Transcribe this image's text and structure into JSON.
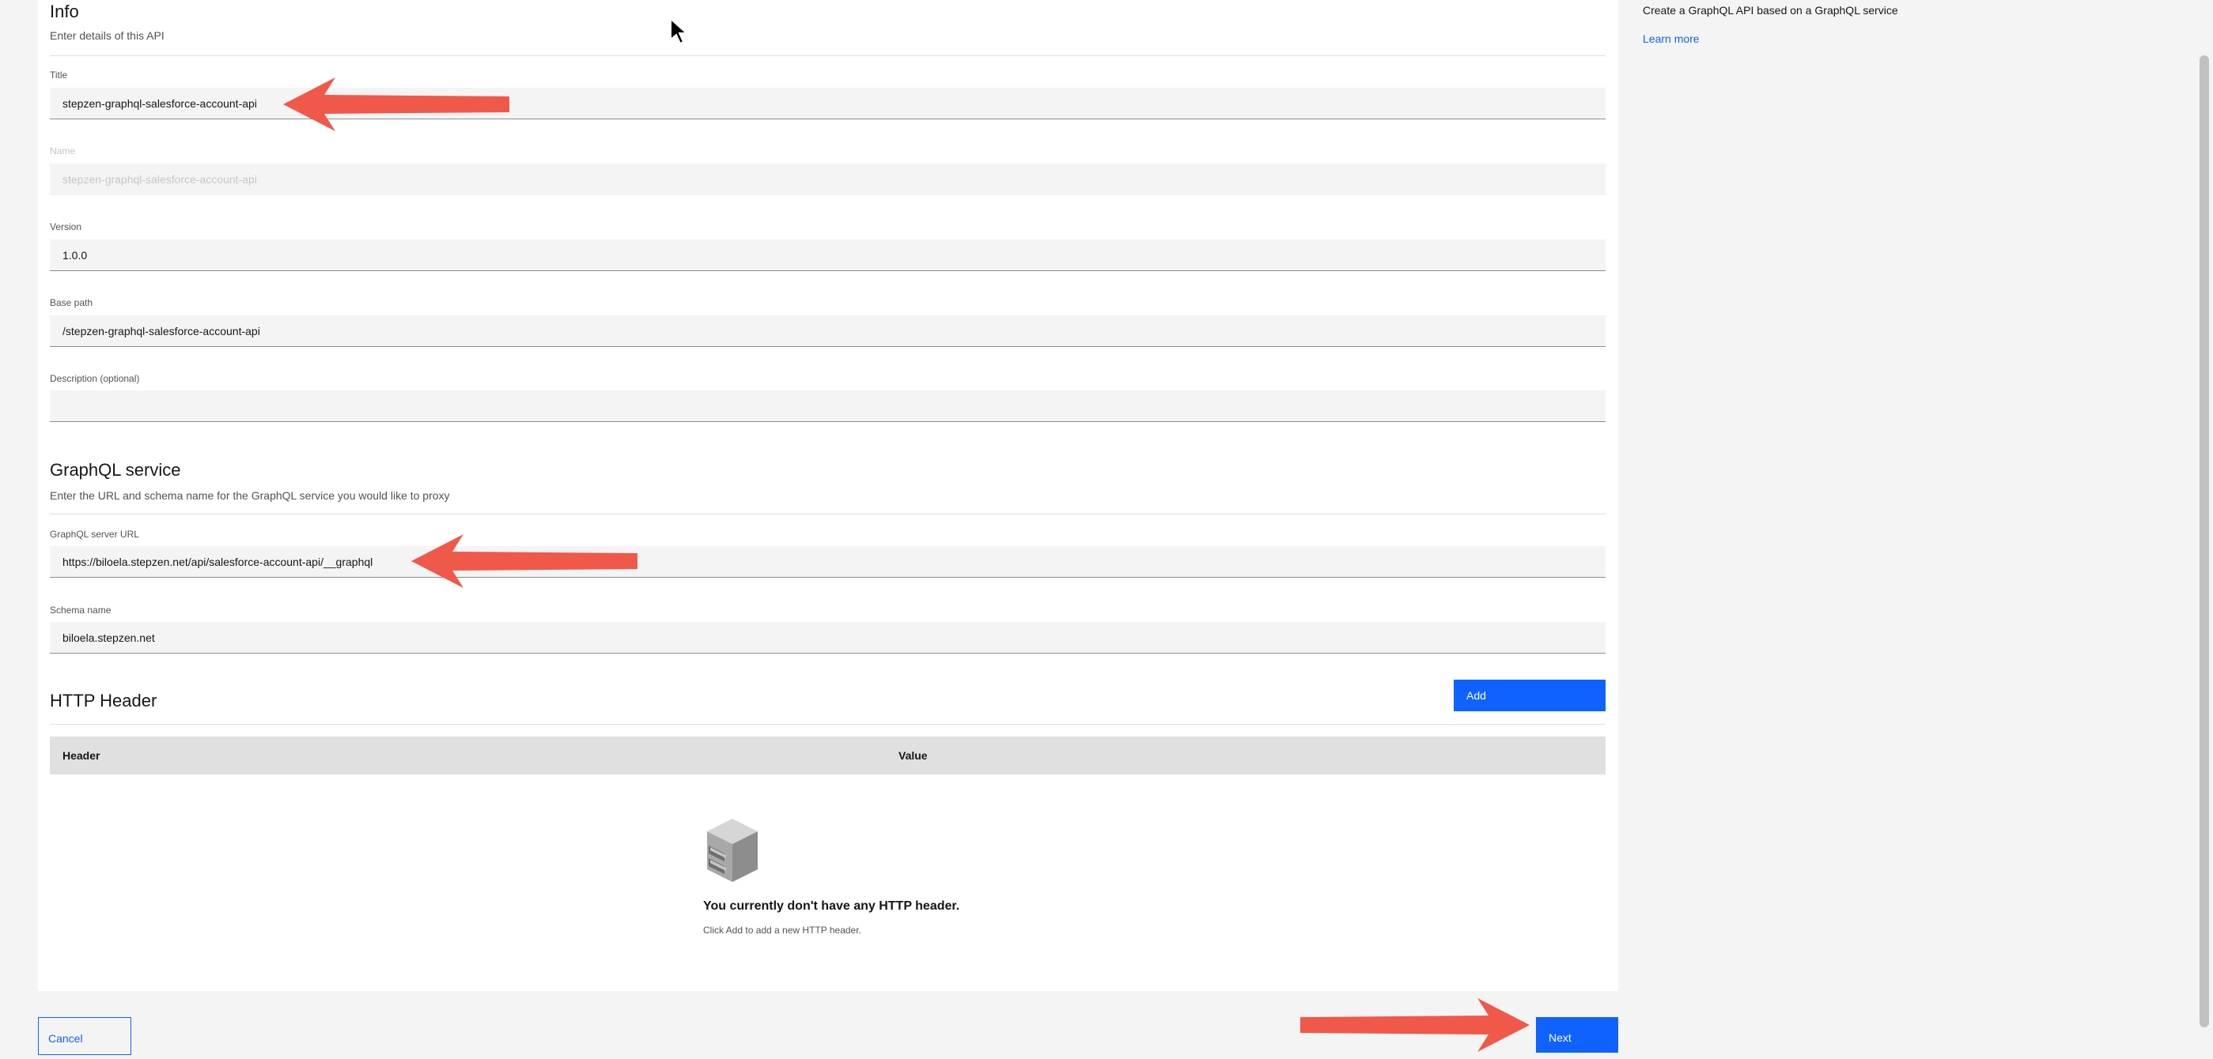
{
  "info": {
    "heading": "Info",
    "subtitle": "Enter details of this API"
  },
  "fields": {
    "title": {
      "label": "Title",
      "value": "stepzen-graphql-salesforce-account-api"
    },
    "name": {
      "label": "Name",
      "value": "stepzen-graphql-salesforce-account-api"
    },
    "version": {
      "label": "Version",
      "value": "1.0.0"
    },
    "base_path": {
      "label": "Base path",
      "value": "/stepzen-graphql-salesforce-account-api"
    },
    "description": {
      "label": "Description (optional)",
      "value": ""
    }
  },
  "graphql": {
    "heading": "GraphQL service",
    "subtitle": "Enter the URL and schema name for the GraphQL service you would like to proxy",
    "server_url": {
      "label": "GraphQL server URL",
      "value": "https://biloela.stepzen.net/api/salesforce-account-api/__graphql"
    },
    "schema_name": {
      "label": "Schema name",
      "value": "biloela.stepzen.net"
    }
  },
  "http_header": {
    "heading": "HTTP Header",
    "add_label": "Add",
    "columns": [
      "Header",
      "Value"
    ],
    "empty_title": "You currently don't have any HTTP header.",
    "empty_subtitle": "Click Add to add a new HTTP header."
  },
  "side": {
    "description": "Create a GraphQL API based on a GraphQL service",
    "learn_more": "Learn more"
  },
  "footer": {
    "cancel_label": "Cancel",
    "next_label": "Next"
  },
  "colors": {
    "primary": "#0f62fe",
    "annotation_arrow": "#f0584a"
  }
}
